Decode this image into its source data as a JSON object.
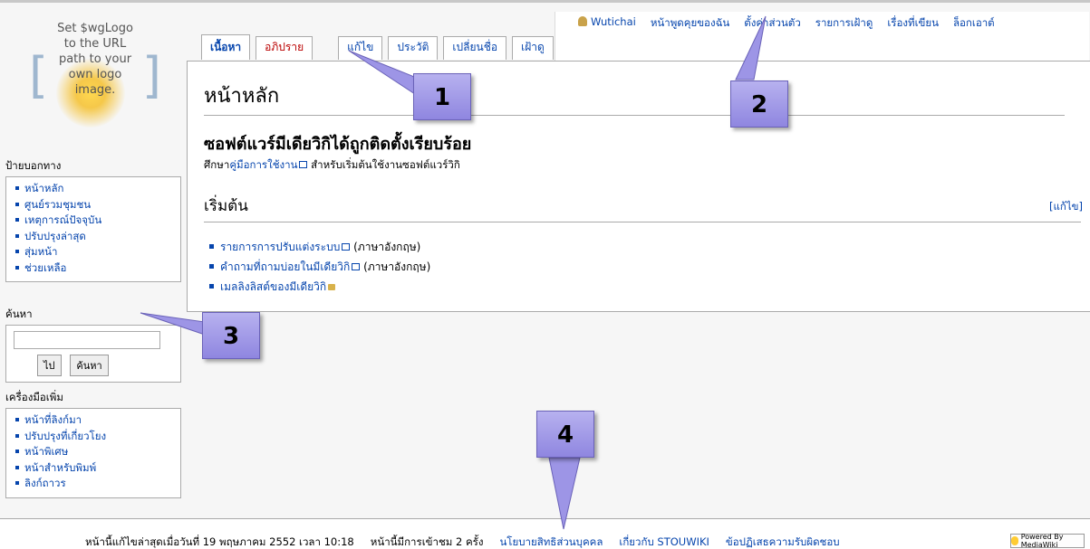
{
  "personal": {
    "items": [
      "Wutichai",
      "หน้าพูดคุยของฉัน",
      "ตั้งค่าส่วนตัว",
      "รายการเฝ้าดู",
      "เรื่องที่เขียน",
      "ล็อกเอาต์"
    ]
  },
  "logo": {
    "lines": [
      "Set $wgLogo",
      "to the URL",
      "path to your",
      "own logo",
      "image."
    ]
  },
  "tabs": [
    {
      "label": "เนื้อหา",
      "state": "selected"
    },
    {
      "label": "อภิปราย",
      "state": "new"
    },
    {
      "label": "แก้ไข",
      "state": "normal"
    },
    {
      "label": "ประวัติ",
      "state": "normal"
    },
    {
      "label": "เปลี่ยนชื่อ",
      "state": "normal"
    },
    {
      "label": "เฝ้าดู",
      "state": "normal"
    }
  ],
  "content": {
    "title": "หน้าหลัก",
    "big_text": "ซอฟต์แวร์มีเดียวิกิได้ถูกติดตั้งเรียบร้อย",
    "intro_prefix": "ศึกษา",
    "intro_link": "คู่มือการใช้งาน",
    "intro_suffix": " สำหรับเริ่มต้นใช้งานซอฟต์แวร์วิกิ",
    "section": "เริ่มต้น",
    "edit": "[แก้ไข]",
    "links": [
      {
        "text": "รายการการปรับแต่งระบบ",
        "note": " (ภาษาอังกฤษ)",
        "icon": "external-link-icon"
      },
      {
        "text": "คำถามที่ถามบ่อยในมีเดียวิกิ",
        "note": " (ภาษาอังกฤษ)",
        "icon": "external-link-icon"
      },
      {
        "text": "เมลลิงลิสต์ของมีเดียวิกิ",
        "note": "",
        "icon": "lock-icon"
      }
    ]
  },
  "navigation": {
    "title": "ป้ายบอกทาง",
    "items": [
      "หน้าหลัก",
      "ศูนย์รวมชุมชน",
      "เหตุการณ์ปัจจุบัน",
      "ปรับปรุงล่าสุด",
      "สุ่มหน้า",
      "ช่วยเหลือ"
    ]
  },
  "search": {
    "title": "ค้นหา",
    "go": "ไป",
    "search": "ค้นหา"
  },
  "toolbox": {
    "title": "เครื่องมือเพิ่ม",
    "items": [
      "หน้าที่ลิงก์มา",
      "ปรับปรุงที่เกี่ยวโยง",
      "หน้าพิเศษ",
      "หน้าสำหรับพิมพ์",
      "ลิงก์ถาวร"
    ]
  },
  "footer": {
    "lastmod": "หน้านี้แก้ไขล่าสุดเมื่อวันที่ 19 พฤษภาคม 2552 เวลา 10:18",
    "views": "หน้านี้มีการเข้าชม 2 ครั้ง",
    "privacy": "นโยบายสิทธิส่วนบุคคล",
    "about": "เกี่ยวกับ STOUWIKI",
    "disclaimer": "ข้อปฏิเสธความรับผิดชอบ",
    "powered": "Powered By MediaWiki"
  },
  "callouts": [
    "1",
    "2",
    "3",
    "4"
  ],
  "colors": {
    "link": "#0645ad",
    "new_link": "#ba0000",
    "callout": "#9d95e6"
  }
}
